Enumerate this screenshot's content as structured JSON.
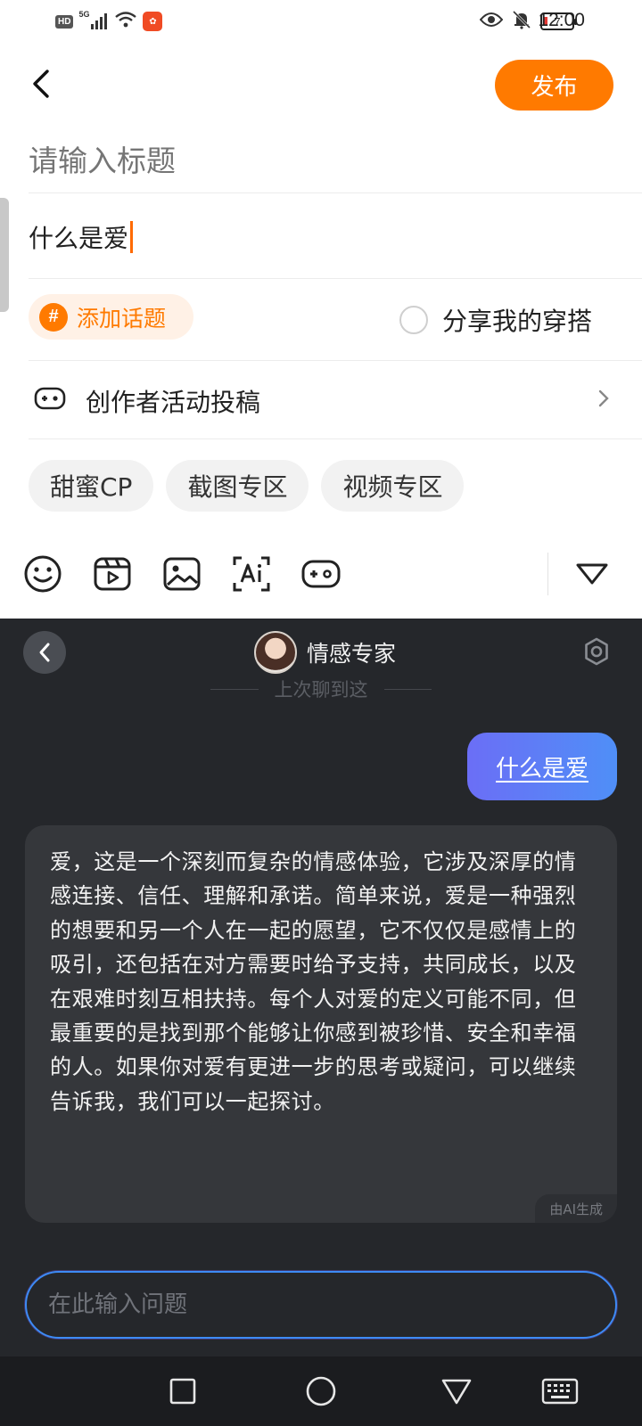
{
  "status_bar": {
    "hd": "HD",
    "network": "5G",
    "battery": "7",
    "time": "12:00"
  },
  "editor": {
    "publish_label": "发布",
    "title_placeholder": "请输入标题",
    "body_text": "什么是爱",
    "add_topic_label": "添加话题",
    "share_outfit_label": "分享我的穿搭",
    "creator_activity_label": "创作者活动投稿",
    "chips": [
      "甜蜜CP",
      "截图专区",
      "视频专区"
    ]
  },
  "ai_chat": {
    "bot_name": "情感专家",
    "last_chat_label": "上次聊到这",
    "user_message": "什么是爱",
    "bot_reply": "爱，这是一个深刻而复杂的情感体验，它涉及深厚的情感连接、信任、理解和承诺。简单来说，爱是一种强烈的想要和另一个人在一起的愿望，它不仅仅是感情上的吸引，还包括在对方需要时给予支持，共同成长，以及在艰难时刻互相扶持。每个人对爱的定义可能不同，但最重要的是找到那个能够让你感到被珍惜、安全和幸福的人。如果你对爱有更进一步的思考或疑问，可以继续告诉我，我们可以一起探讨。",
    "ai_generated_tag": "由AI生成",
    "input_placeholder": "在此输入问题"
  },
  "colors": {
    "accent": "#ff7a00",
    "dark_panel": "#25272b",
    "user_bubble_start": "#6b6ef6",
    "user_bubble_end": "#4f8ff7"
  }
}
